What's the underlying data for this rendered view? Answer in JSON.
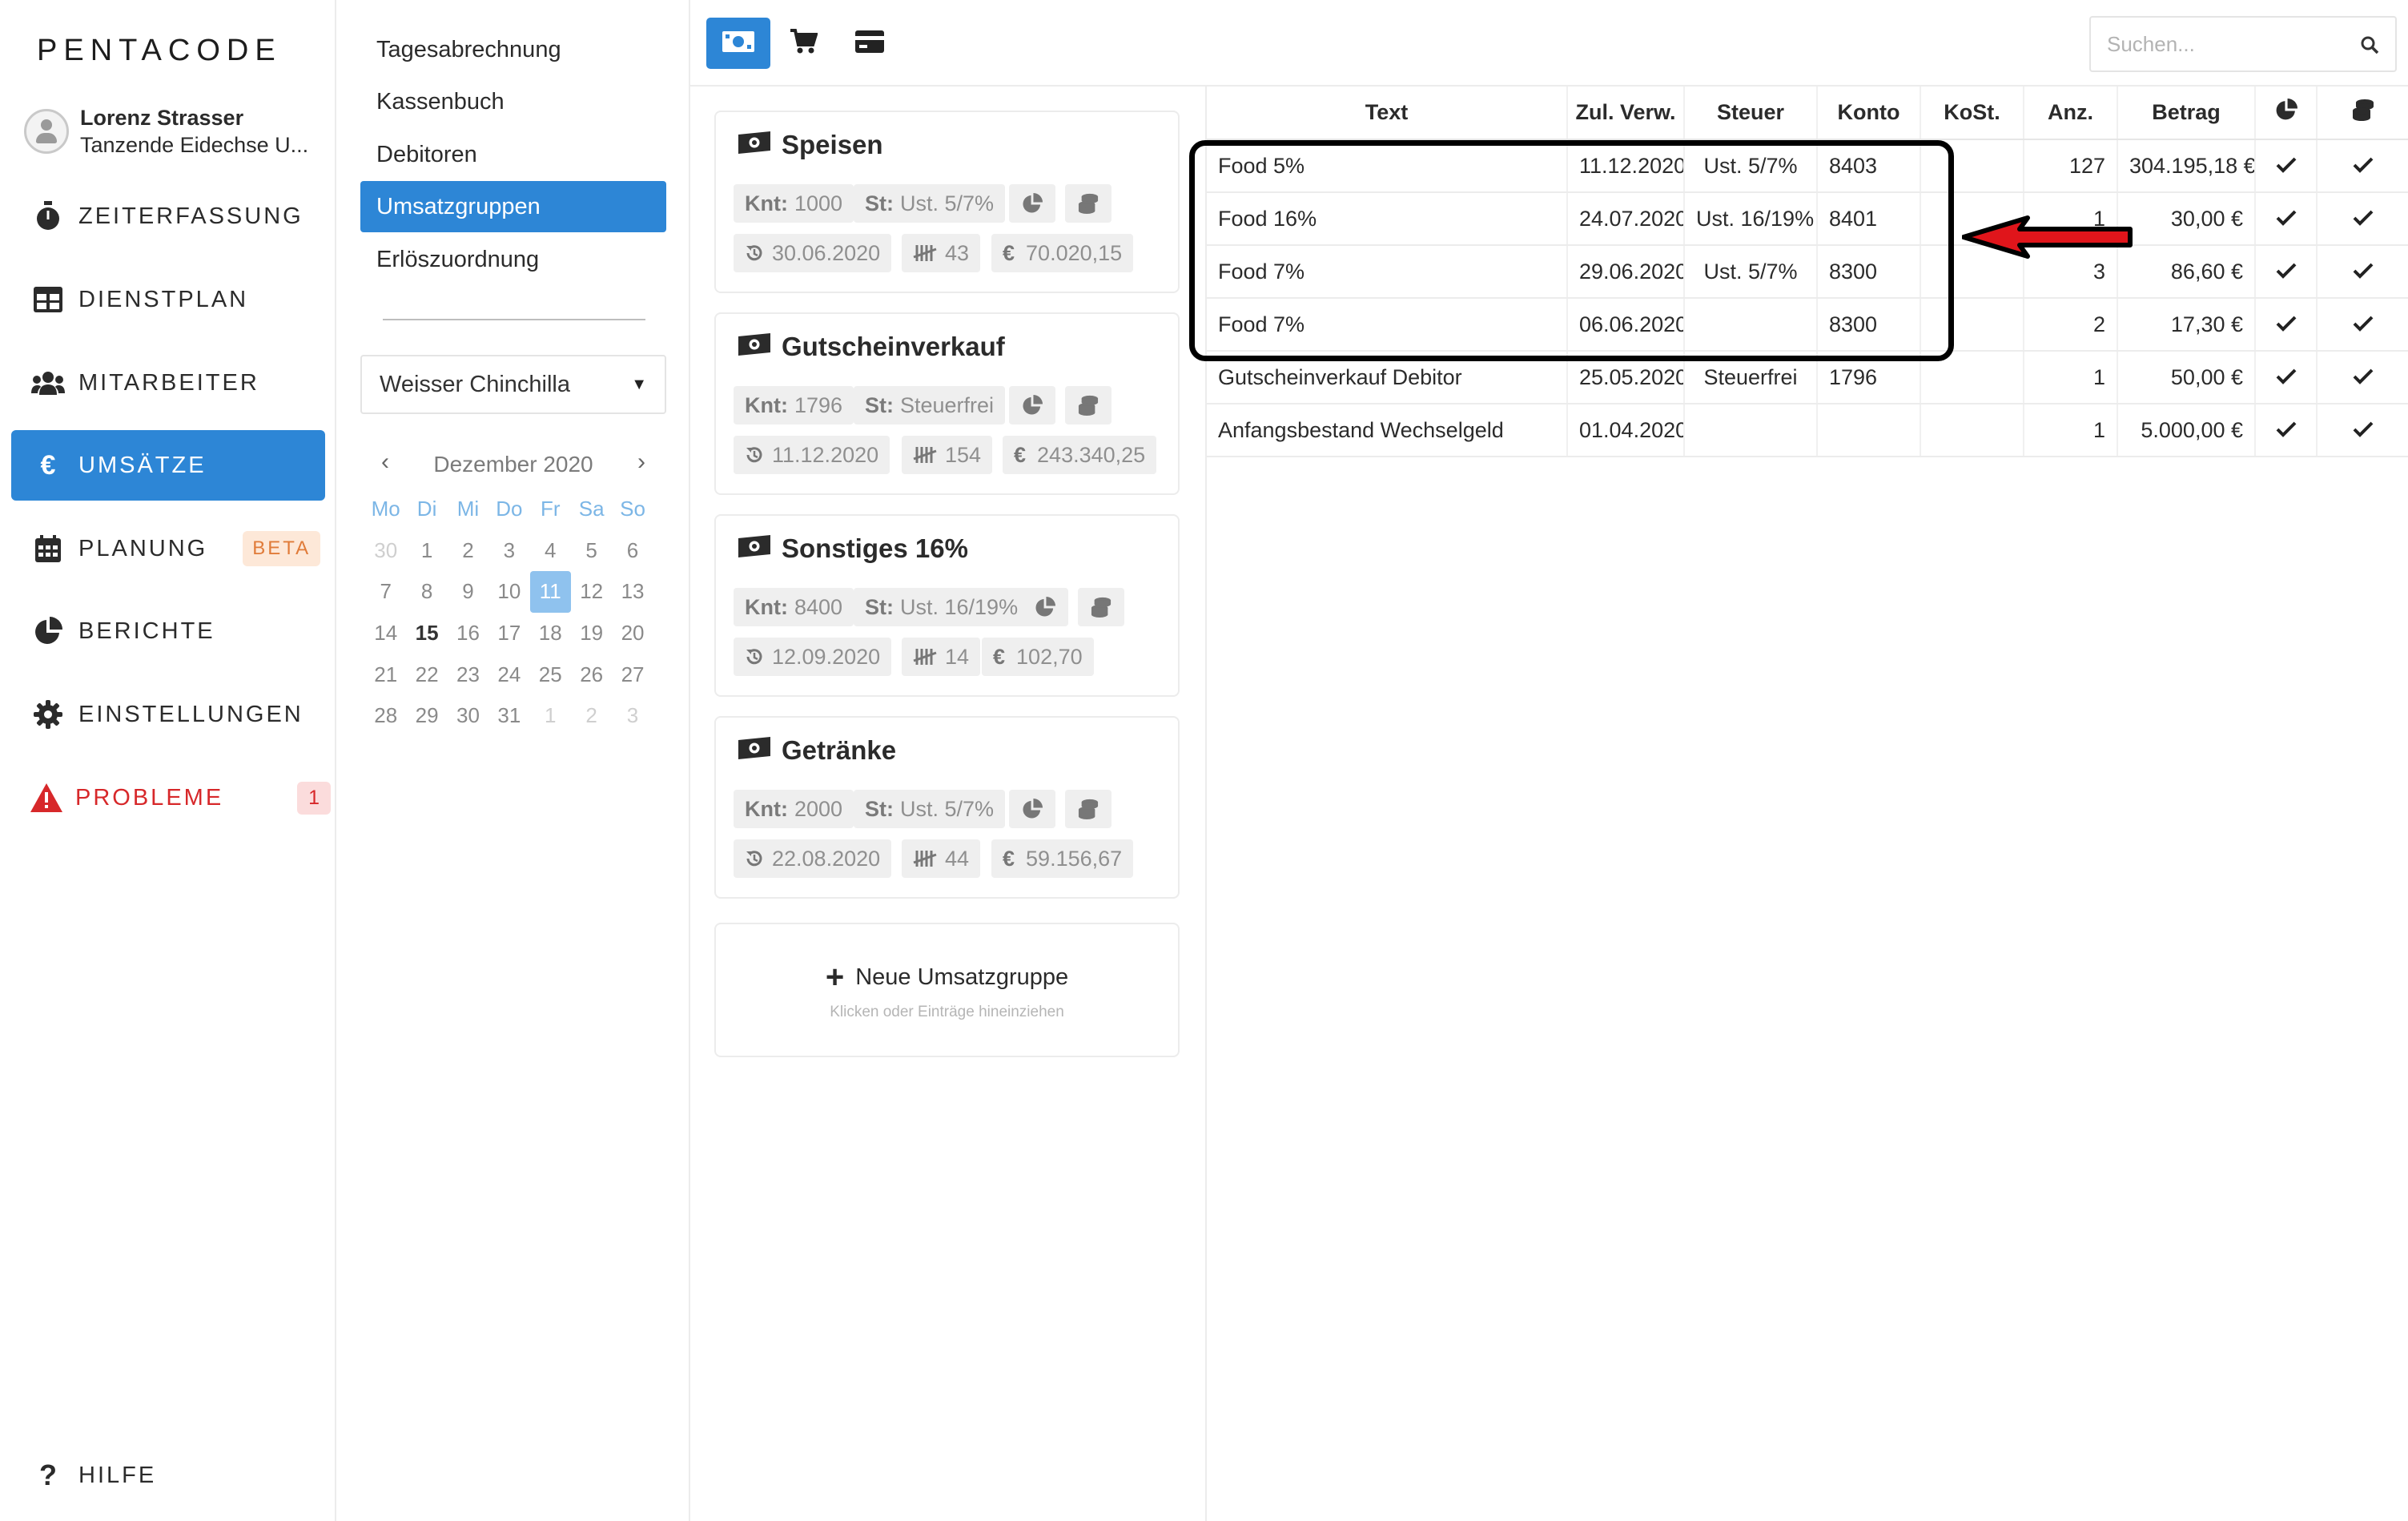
{
  "app": {
    "logo": "PENTACODE",
    "user_name": "Lorenz Strasser",
    "user_company": "Tanzende Eidechse U..."
  },
  "sidebar": {
    "items": [
      {
        "label": "ZEITERFASSUNG",
        "icon": "stopwatch-icon"
      },
      {
        "label": "DIENSTPLAN",
        "icon": "table-icon"
      },
      {
        "label": "MITARBEITER",
        "icon": "users-icon"
      },
      {
        "label": "UMSÄTZE",
        "icon": "euro-icon",
        "active": true
      },
      {
        "label": "PLANUNG",
        "icon": "calendar-icon",
        "badge": "BETA"
      },
      {
        "label": "BERICHTE",
        "icon": "pie-chart-icon"
      },
      {
        "label": "EINSTELLUNGEN",
        "icon": "gear-icon"
      },
      {
        "label": "PROBLEME",
        "icon": "warning-icon",
        "badge": "1"
      }
    ],
    "help_label": "HILFE"
  },
  "subnav": {
    "items": [
      "Tagesabrechnung",
      "Kassenbuch",
      "Debitoren",
      "Umsatzgruppen",
      "Erlöszuordnung"
    ],
    "active": "Umsatzgruppen",
    "location_select": "Weisser Chinchilla"
  },
  "calendar": {
    "month_label": "Dezember 2020",
    "weekdays": [
      "Mo",
      "Di",
      "Mi",
      "Do",
      "Fr",
      "Sa",
      "So"
    ],
    "weeks": [
      [
        "30",
        "1",
        "2",
        "3",
        "4",
        "5",
        "6"
      ],
      [
        "7",
        "8",
        "9",
        "10",
        "11",
        "12",
        "13"
      ],
      [
        "14",
        "15",
        "16",
        "17",
        "18",
        "19",
        "20"
      ],
      [
        "21",
        "22",
        "23",
        "24",
        "25",
        "26",
        "27"
      ],
      [
        "28",
        "29",
        "30",
        "31",
        "1",
        "2",
        "3"
      ]
    ],
    "selected_day": "11",
    "bold_day": "15"
  },
  "groups": [
    {
      "title": "Speisen",
      "knt_label": "Knt:",
      "knt": "1000",
      "st_label": "St:",
      "st": "Ust. 5/7%",
      "date": "30.06.2020",
      "count": "43",
      "amount": "70.020,15"
    },
    {
      "title": "Gutscheinverkauf",
      "knt_label": "Knt:",
      "knt": "1796",
      "st_label": "St:",
      "st": "Steuerfrei",
      "date": "11.12.2020",
      "count": "154",
      "amount": "243.340,25"
    },
    {
      "title": "Sonstiges 16%",
      "knt_label": "Knt:",
      "knt": "8400",
      "st_label": "St:",
      "st": "Ust. 16/19%",
      "date": "12.09.2020",
      "count": "14",
      "amount": "102,70"
    },
    {
      "title": "Getränke",
      "knt_label": "Knt:",
      "knt": "2000",
      "st_label": "St:",
      "st": "Ust. 5/7%",
      "date": "22.08.2020",
      "count": "44",
      "amount": "59.156,67"
    }
  ],
  "new_group": {
    "label": "Neue Umsatzgruppe",
    "hint": "Klicken oder Einträge hineinziehen"
  },
  "search": {
    "placeholder": "Suchen..."
  },
  "table": {
    "headers": [
      "Text",
      "Zul. Verw.",
      "Steuer",
      "Konto",
      "KoSt.",
      "Anz.",
      "Betrag"
    ],
    "rows": [
      {
        "text": "Food 5%",
        "date": "11.12.2020",
        "tax": "Ust. 5/7%",
        "account": "8403",
        "cost": "",
        "count": "127",
        "amount": "304.195,18 €"
      },
      {
        "text": "Food 16%",
        "date": "24.07.2020",
        "tax": "Ust. 16/19%",
        "account": "8401",
        "cost": "",
        "count": "1",
        "amount": "30,00 €"
      },
      {
        "text": "Food 7%",
        "date": "29.06.2020",
        "tax": "Ust. 5/7%",
        "account": "8300",
        "cost": "",
        "count": "3",
        "amount": "86,60 €"
      },
      {
        "text": "Food 7%",
        "date": "06.06.2020",
        "tax": "",
        "account": "8300",
        "cost": "",
        "count": "2",
        "amount": "17,30 €"
      },
      {
        "text": "Gutscheinverkauf Debitor",
        "date": "25.05.2020",
        "tax": "Steuerfrei",
        "account": "1796",
        "cost": "",
        "count": "1",
        "amount": "50,00 €"
      },
      {
        "text": "Anfangsbestand Wechselgeld",
        "date": "01.04.2020",
        "tax": "",
        "account": "",
        "cost": "",
        "count": "1",
        "amount": "5.000,00 €"
      }
    ]
  },
  "colors": {
    "accent": "#2d86d6",
    "danger": "#d7282a",
    "annotation_arrow": "#e0151b"
  }
}
